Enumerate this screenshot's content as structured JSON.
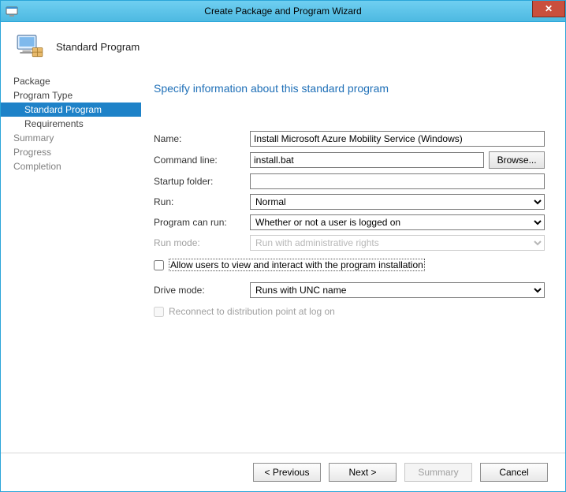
{
  "window": {
    "title": "Create Package and Program Wizard",
    "close_glyph": "✕"
  },
  "header": {
    "title": "Standard Program"
  },
  "nav": {
    "items": [
      {
        "label": "Package",
        "sub": false,
        "selected": false,
        "dim": false
      },
      {
        "label": "Program Type",
        "sub": false,
        "selected": false,
        "dim": false
      },
      {
        "label": "Standard Program",
        "sub": true,
        "selected": true,
        "dim": false
      },
      {
        "label": "Requirements",
        "sub": true,
        "selected": false,
        "dim": false
      },
      {
        "label": "Summary",
        "sub": false,
        "selected": false,
        "dim": true
      },
      {
        "label": "Progress",
        "sub": false,
        "selected": false,
        "dim": true
      },
      {
        "label": "Completion",
        "sub": false,
        "selected": false,
        "dim": true
      }
    ]
  },
  "content": {
    "title": "Specify information about this standard program",
    "labels": {
      "name": "Name:",
      "command_line": "Command line:",
      "startup_folder": "Startup folder:",
      "run": "Run:",
      "program_can_run": "Program can run:",
      "run_mode": "Run mode:",
      "drive_mode": "Drive mode:"
    },
    "values": {
      "name": "Install Microsoft Azure Mobility Service (Windows)",
      "command_line": "install.bat",
      "startup_folder": "",
      "run": "Normal",
      "program_can_run": "Whether or not a user is logged on",
      "run_mode": "Run with administrative rights",
      "drive_mode": "Runs with UNC name"
    },
    "browse_label": "Browse...",
    "allow_users_label": "Allow users to view and interact with the program installation",
    "reconnect_label": "Reconnect to distribution point at log on"
  },
  "footer": {
    "previous": "< Previous",
    "next": "Next >",
    "summary": "Summary",
    "cancel": "Cancel"
  }
}
